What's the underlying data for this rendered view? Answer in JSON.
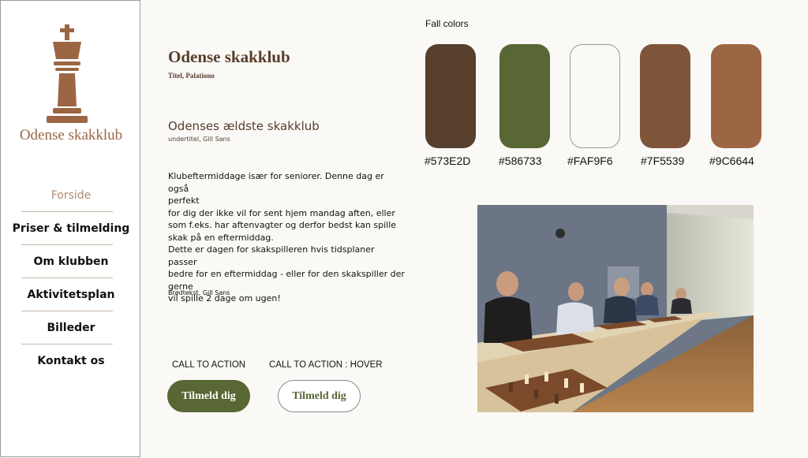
{
  "sidebar": {
    "logo_text": "Odense skakklub",
    "nav": [
      {
        "label": "Forside",
        "active": true
      },
      {
        "label": "Priser & tilmelding"
      },
      {
        "label": "Om klubben"
      },
      {
        "label": "Aktivitetsplan"
      },
      {
        "label": "Billeder"
      },
      {
        "label": "Kontakt os"
      }
    ]
  },
  "typography": {
    "title": "Odense skakklub",
    "title_caption": "Titel, Palationo",
    "subtitle": "Odenses ældste skakklub",
    "subtitle_caption": "undertitel, Gill Sans",
    "body_lines": [
      "Klubeftermiddage især for seniorer. Denne dag er også",
      "perfekt",
      "for dig der ikke vil for sent hjem mandag aften, eller",
      "som f.eks. har aftenvagter og derfor bedst kan spille",
      "skak på en eftermiddag.",
      "Dette er dagen for skakspilleren hvis tidsplaner passer",
      "bedre for en eftermiddag - eller for den skakspiller der",
      "gerne",
      "vil spille 2 dage om ugen!"
    ],
    "body_caption": "Brødtekst, Gill Sans"
  },
  "cta": {
    "label_default": "CALL TO ACTION",
    "label_hover": "CALL TO ACTION : HOVER",
    "button_label": "Tilmeld dig",
    "hover_button_label": "Tilmeld dig"
  },
  "palette": {
    "title": "Fall colors",
    "colors": [
      {
        "hex": "#573E2D",
        "label": "#573E2D"
      },
      {
        "hex": "#586733",
        "label": "#586733"
      },
      {
        "hex": "#FAF9F6",
        "label": "#FAF9F6"
      },
      {
        "hex": "#7F5539",
        "label": "#7F5539"
      },
      {
        "hex": "#9C6644",
        "label": "#9C6644"
      }
    ]
  },
  "photo": {
    "icon": "chess-club-photo"
  }
}
